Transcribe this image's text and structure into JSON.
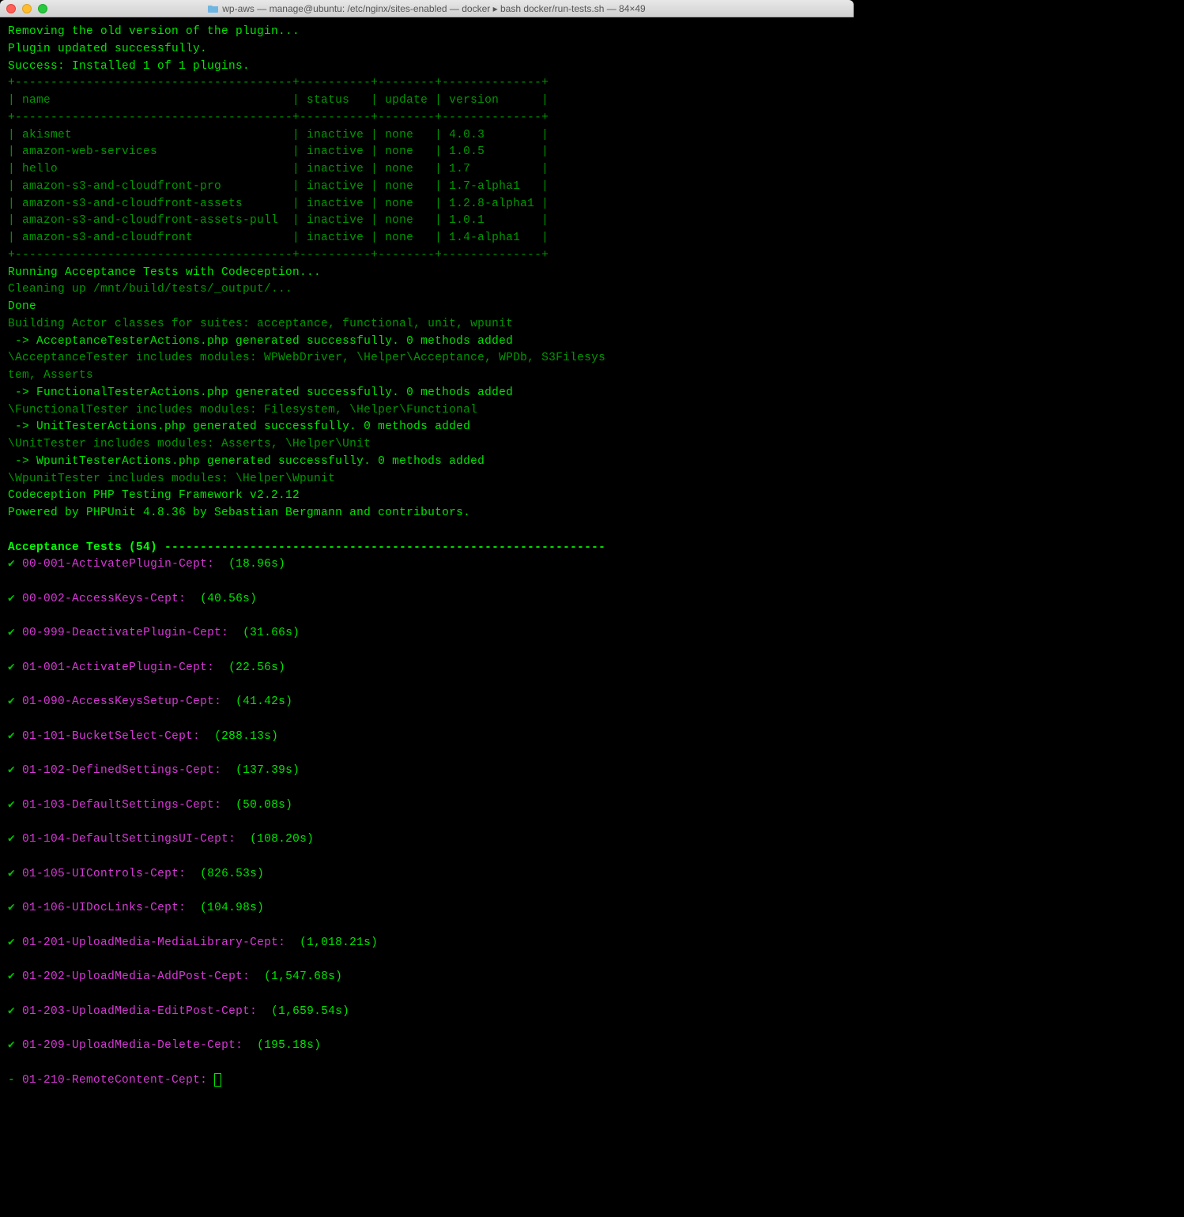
{
  "window": {
    "title": "wp-aws — manage@ubuntu: /etc/nginx/sites-enabled — docker ▸ bash docker/run-tests.sh — 84×49"
  },
  "header_lines": [
    "Removing the old version of the plugin...",
    "Plugin updated successfully.",
    "Success: Installed 1 of 1 plugins."
  ],
  "table": {
    "divider_top": "+---------------------------------------+----------+--------+--------------+",
    "header_row": "| name                                  | status   | update | version      |",
    "divider_mid": "+---------------------------------------+----------+--------+--------------+",
    "rows": [
      "| akismet                               | inactive | none   | 4.0.3        |",
      "| amazon-web-services                   | inactive | none   | 1.0.5        |",
      "| hello                                 | inactive | none   | 1.7          |",
      "| amazon-s3-and-cloudfront-pro          | inactive | none   | 1.7-alpha1   |",
      "| amazon-s3-and-cloudfront-assets       | inactive | none   | 1.2.8-alpha1 |",
      "| amazon-s3-and-cloudfront-assets-pull  | inactive | none   | 1.0.1        |",
      "| amazon-s3-and-cloudfront              | inactive | none   | 1.4-alpha1   |"
    ],
    "divider_bot": "+---------------------------------------+----------+--------+--------------+"
  },
  "build_lines": [
    {
      "text": "Running Acceptance Tests with Codeception...",
      "cls": ""
    },
    {
      "text": "Cleaning up /mnt/build/tests/_output/...",
      "cls": "dim-green"
    },
    {
      "text": "Done",
      "cls": ""
    },
    {
      "text": "Building Actor classes for suites: acceptance, functional, unit, wpunit",
      "cls": "dim-green"
    },
    {
      "text": " -> AcceptanceTesterActions.php generated successfully. 0 methods added",
      "cls": ""
    },
    {
      "text": "\\AcceptanceTester includes modules: WPWebDriver, \\Helper\\Acceptance, WPDb, S3Filesys",
      "cls": "dim-green"
    },
    {
      "text": "tem, Asserts",
      "cls": "dim-green"
    },
    {
      "text": " -> FunctionalTesterActions.php generated successfully. 0 methods added",
      "cls": ""
    },
    {
      "text": "\\FunctionalTester includes modules: Filesystem, \\Helper\\Functional",
      "cls": "dim-green"
    },
    {
      "text": " -> UnitTesterActions.php generated successfully. 0 methods added",
      "cls": ""
    },
    {
      "text": "\\UnitTester includes modules: Asserts, \\Helper\\Unit",
      "cls": "dim-green"
    },
    {
      "text": " -> WpunitTesterActions.php generated successfully. 0 methods added",
      "cls": ""
    },
    {
      "text": "\\WpunitTester includes modules: \\Helper\\Wpunit",
      "cls": "dim-green"
    },
    {
      "text": "Codeception PHP Testing Framework v2.2.12",
      "cls": ""
    },
    {
      "text": "Powered by PHPUnit 4.8.36 by Sebastian Bergmann and contributors.",
      "cls": ""
    }
  ],
  "suite_header": "Acceptance Tests (54) --------------------------------------------------------------",
  "tests": [
    {
      "mark": "✔",
      "name": "00-001-ActivatePlugin-Cept:",
      "time": "(18.96s)"
    },
    {
      "mark": "✔",
      "name": "00-002-AccessKeys-Cept:",
      "time": "(40.56s)"
    },
    {
      "mark": "✔",
      "name": "00-999-DeactivatePlugin-Cept:",
      "time": "(31.66s)"
    },
    {
      "mark": "✔",
      "name": "01-001-ActivatePlugin-Cept:",
      "time": "(22.56s)"
    },
    {
      "mark": "✔",
      "name": "01-090-AccessKeysSetup-Cept:",
      "time": "(41.42s)"
    },
    {
      "mark": "✔",
      "name": "01-101-BucketSelect-Cept:",
      "time": "(288.13s)"
    },
    {
      "mark": "✔",
      "name": "01-102-DefinedSettings-Cept:",
      "time": "(137.39s)"
    },
    {
      "mark": "✔",
      "name": "01-103-DefaultSettings-Cept:",
      "time": "(50.08s)"
    },
    {
      "mark": "✔",
      "name": "01-104-DefaultSettingsUI-Cept:",
      "time": "(108.20s)"
    },
    {
      "mark": "✔",
      "name": "01-105-UIControls-Cept:",
      "time": "(826.53s)"
    },
    {
      "mark": "✔",
      "name": "01-106-UIDocLinks-Cept:",
      "time": "(104.98s)"
    },
    {
      "mark": "✔",
      "name": "01-201-UploadMedia-MediaLibrary-Cept:",
      "time": "(1,018.21s)"
    },
    {
      "mark": "✔",
      "name": "01-202-UploadMedia-AddPost-Cept:",
      "time": "(1,547.68s)"
    },
    {
      "mark": "✔",
      "name": "01-203-UploadMedia-EditPost-Cept:",
      "time": "(1,659.54s)"
    },
    {
      "mark": "✔",
      "name": "01-209-UploadMedia-Delete-Cept:",
      "time": "(195.18s)"
    },
    {
      "mark": "-",
      "name": "01-210-RemoteContent-Cept:",
      "time": ""
    }
  ]
}
